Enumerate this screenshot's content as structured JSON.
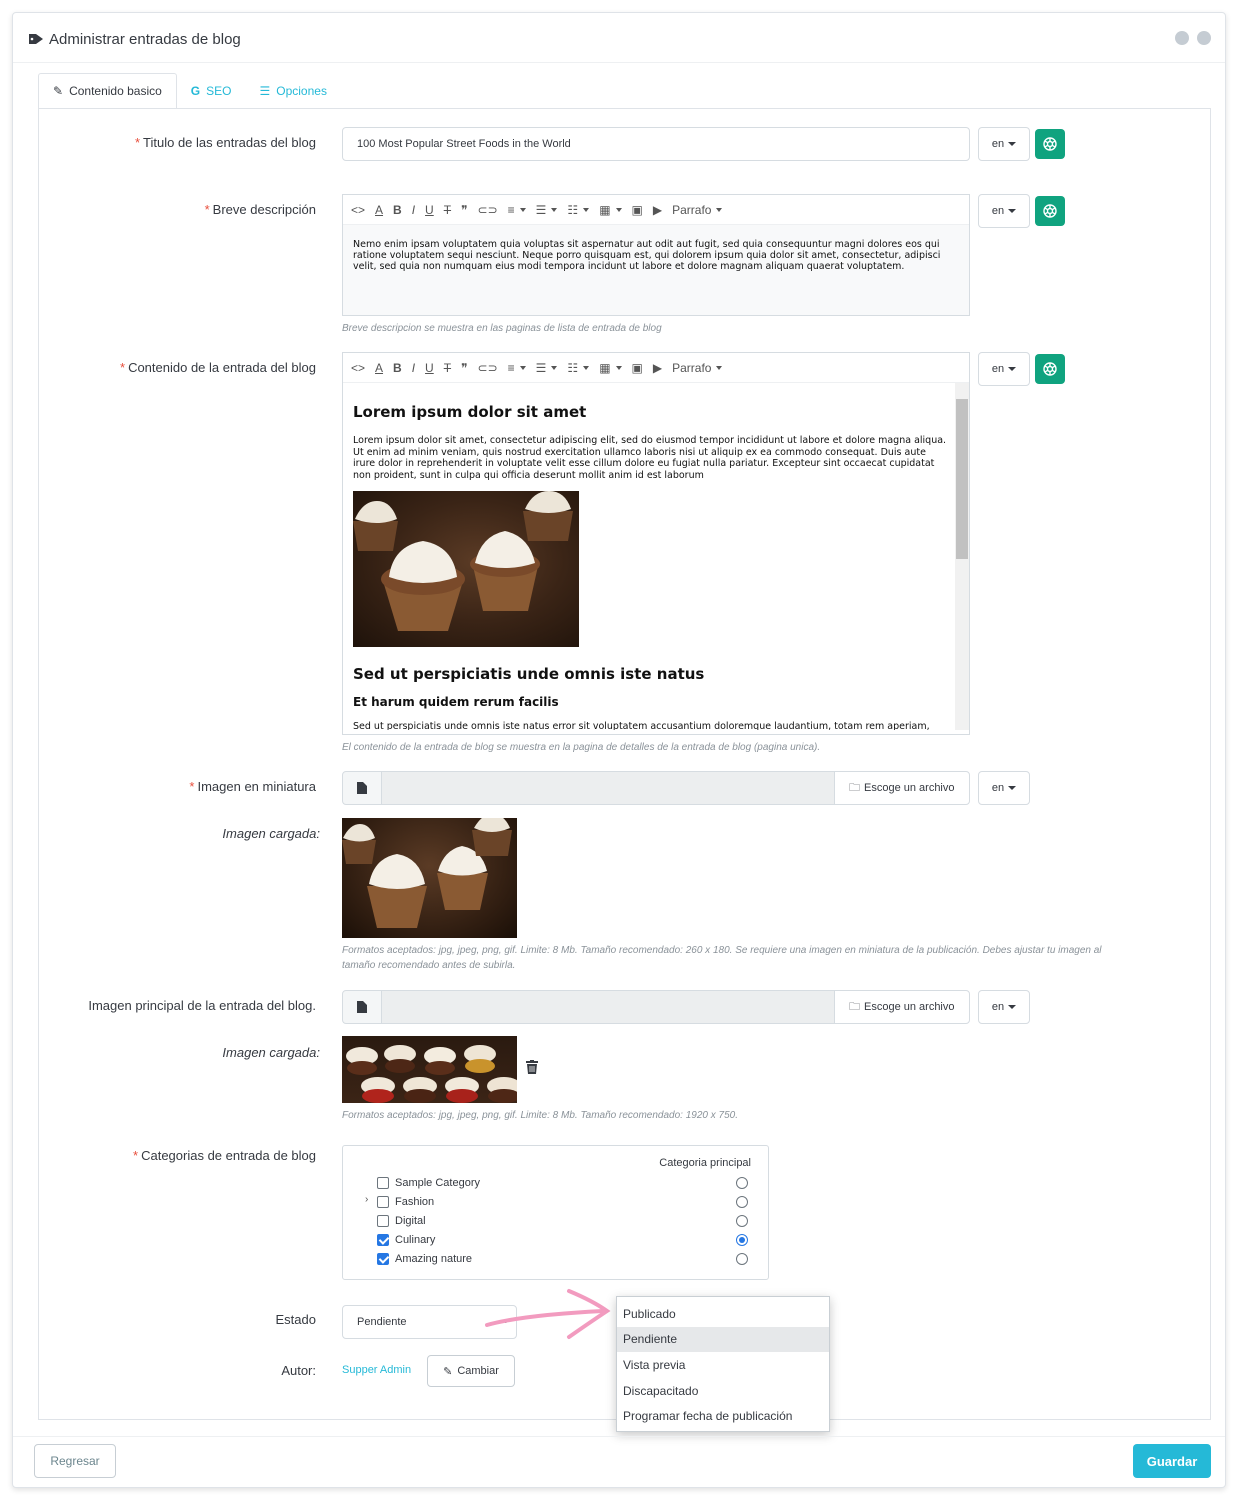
{
  "panel": {
    "title": "Administrar entradas de blog"
  },
  "tabs": [
    {
      "label": "Contenido basico",
      "icon": "edit-icon"
    },
    {
      "label": "SEO",
      "icon": "google-icon"
    },
    {
      "label": "Opciones",
      "icon": "list-icon"
    }
  ],
  "lang_label": "en",
  "title_field": {
    "label": "Titulo de las entradas del blog",
    "value": "100 Most Popular Street Foods in the World"
  },
  "short_desc": {
    "label": "Breve descripción",
    "text": "Nemo enim ipsam voluptatem quia voluptas sit aspernatur aut odit aut fugit, sed quia consequuntur magni dolores eos qui ratione voluptatem sequi nesciunt. Neque porro quisquam est, qui dolorem ipsum quia dolor sit amet, consectetur, adipisci velit, sed quia non numquam eius modi tempora incidunt ut labore et dolore magnam aliquam quaerat voluptatem.",
    "help": "Breve descripcion se muestra en las paginas de lista de entrada de blog"
  },
  "toolbar": {
    "paragraph": "Parrafo"
  },
  "content": {
    "label": "Contenido de la entrada del blog",
    "h1": "Lorem ipsum dolor sit amet",
    "p1": "Lorem ipsum dolor sit amet, consectetur adipiscing elit, sed do eiusmod tempor incididunt ut labore et dolore magna aliqua. Ut enim ad minim veniam, quis nostrud exercitation ullamco laboris nisi ut aliquip ex ea commodo consequat. Duis aute irure dolor in reprehenderit in voluptate velit esse cillum dolore eu fugiat nulla pariatur. Excepteur sint occaecat cupidatat non proident, sunt in culpa qui officia deserunt mollit anim id est laborum",
    "h2": "Sed ut perspiciatis unde omnis iste natus",
    "h3": "Et harum quidem rerum facilis",
    "p2": "Sed ut perspiciatis unde omnis iste natus error sit voluptatem accusantium doloremque laudantium, totam rem aperiam, eaque ipsa quae ab illo inventore veritatis et quasi architecto beatae vitae dicta sunt explicabo. Nemo enim",
    "help": "El contenido de la entrada de blog se muestra en la pagina de detalles de la entrada de blog (pagina unica)."
  },
  "thumbnail": {
    "label": "Imagen en miniatura",
    "choose": "Escoge un archivo",
    "uploaded_label": "Imagen cargada:",
    "help": "Formatos aceptados: jpg, jpeg, png, gif. Limite: 8 Mb. Tamaño recomendado: 260 x 180. Se requiere una imagen en miniatura de la publicación. Debes ajustar tu imagen al tamaño recomendado antes de subirla."
  },
  "main_image": {
    "label": "Imagen principal de la entrada del blog.",
    "choose": "Escoge un archivo",
    "uploaded_label": "Imagen cargada:",
    "help": "Formatos aceptados: jpg, jpeg, png, gif. Limite: 8 Mb. Tamaño recomendado: 1920 x 750."
  },
  "categories": {
    "label": "Categorias de entrada de blog",
    "primary_header": "Categoria principal",
    "items": [
      {
        "name": "Sample Category",
        "checked": false,
        "primary": false
      },
      {
        "name": "Fashion",
        "checked": false,
        "primary": false
      },
      {
        "name": "Digital",
        "checked": false,
        "primary": false
      },
      {
        "name": "Culinary",
        "checked": true,
        "primary": true
      },
      {
        "name": "Amazing nature",
        "checked": true,
        "primary": false
      }
    ]
  },
  "status": {
    "label": "Estado",
    "value": "Pendiente",
    "options": [
      "Publicado",
      "Pendiente",
      "Vista previa",
      "Discapacitado",
      "Programar fecha de publicación"
    ]
  },
  "author": {
    "label": "Autor:",
    "name": "Supper Admin",
    "change": "Cambiar"
  },
  "footer": {
    "back": "Regresar",
    "save": "Guardar"
  },
  "colors": {
    "accent": "#25b9d7",
    "required": "#e84e3c",
    "chatgpt": "#10a37f",
    "annotation_arrow": "#f29bbf"
  }
}
